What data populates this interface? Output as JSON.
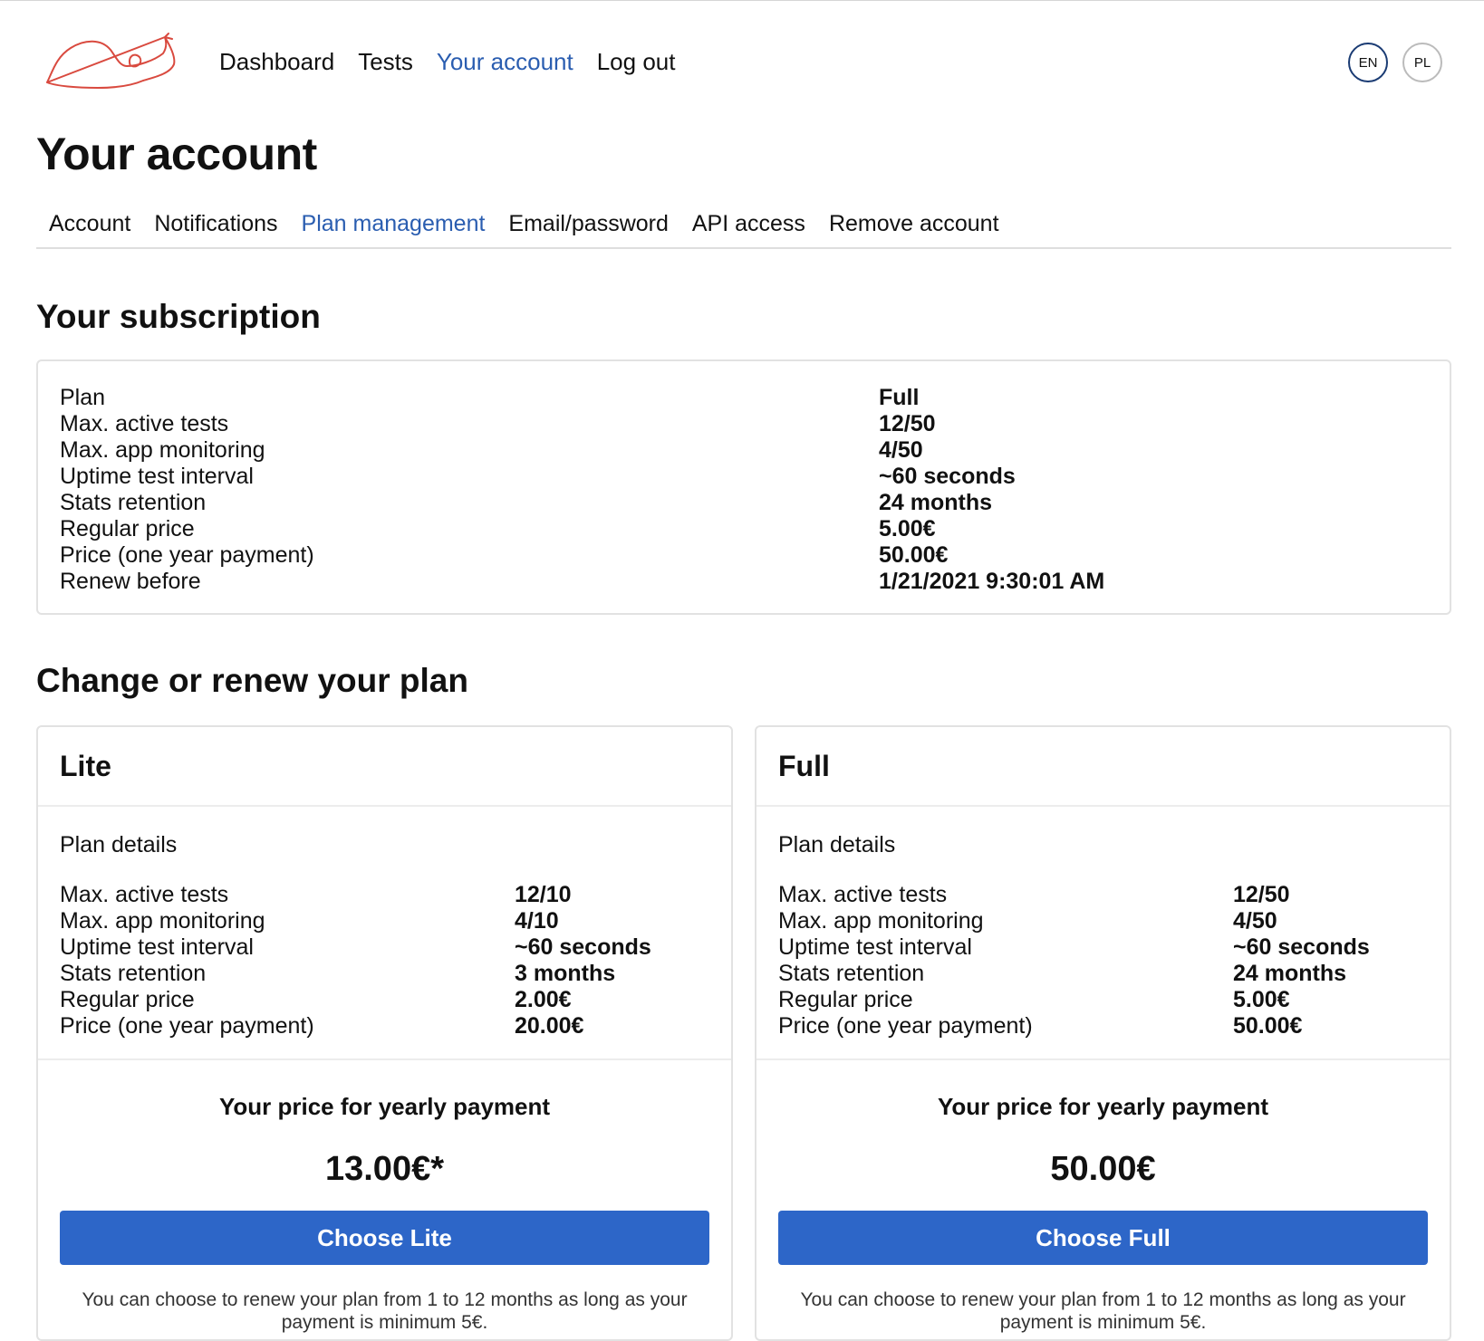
{
  "nav": {
    "items": [
      {
        "label": "Dashboard"
      },
      {
        "label": "Tests"
      },
      {
        "label": "Your account"
      },
      {
        "label": "Log out"
      }
    ],
    "active_index": 2,
    "languages": [
      {
        "label": "EN"
      },
      {
        "label": "PL"
      }
    ],
    "active_language_index": 0
  },
  "page_title": "Your account",
  "tabs": {
    "items": [
      {
        "label": "Account"
      },
      {
        "label": "Notifications"
      },
      {
        "label": "Plan management"
      },
      {
        "label": "Email/password"
      },
      {
        "label": "API access"
      },
      {
        "label": "Remove account"
      }
    ],
    "active_index": 2
  },
  "subscription": {
    "heading": "Your subscription",
    "rows": [
      {
        "label": "Plan",
        "value": "Full"
      },
      {
        "label": "Max. active tests",
        "value": "12/50"
      },
      {
        "label": "Max. app monitoring",
        "value": "4/50"
      },
      {
        "label": "Uptime test interval",
        "value": "~60 seconds"
      },
      {
        "label": "Stats retention",
        "value": "24 months"
      },
      {
        "label": "Regular price",
        "value": "5.00€"
      },
      {
        "label": "Price (one year payment)",
        "value": "50.00€"
      },
      {
        "label": "Renew before",
        "value": "1/21/2021 9:30:01 AM"
      }
    ]
  },
  "change": {
    "heading": "Change or renew your plan",
    "plans": [
      {
        "name": "Lite",
        "details_label": "Plan details",
        "rows": [
          {
            "label": "Max. active tests",
            "value": "12/10"
          },
          {
            "label": "Max. app monitoring",
            "value": "4/10"
          },
          {
            "label": "Uptime test interval",
            "value": "~60 seconds"
          },
          {
            "label": "Stats retention",
            "value": "3 months"
          },
          {
            "label": "Regular price",
            "value": "2.00€"
          },
          {
            "label": "Price (one year payment)",
            "value": "20.00€"
          }
        ],
        "yearly_label": "Your price for yearly payment",
        "yearly_price": "13.00€*",
        "button_label": "Choose Lite",
        "note": "You can choose to renew your plan from 1 to 12 months as long as your payment is minimum 5€."
      },
      {
        "name": "Full",
        "details_label": "Plan details",
        "rows": [
          {
            "label": "Max. active tests",
            "value": "12/50"
          },
          {
            "label": "Max. app monitoring",
            "value": "4/50"
          },
          {
            "label": "Uptime test interval",
            "value": "~60 seconds"
          },
          {
            "label": "Stats retention",
            "value": "24 months"
          },
          {
            "label": "Regular price",
            "value": "5.00€"
          },
          {
            "label": "Price (one year payment)",
            "value": "50.00€"
          }
        ],
        "yearly_label": "Your price for yearly payment",
        "yearly_price": "50.00€",
        "button_label": "Choose Full",
        "note": "You can choose to renew your plan from 1 to 12 months as long as your payment is minimum 5€."
      }
    ]
  },
  "colors": {
    "accent": "#2a5db0",
    "button": "#2d66c8",
    "logo_stroke": "#d94a3f"
  },
  "logo_icon": "snail-icon"
}
